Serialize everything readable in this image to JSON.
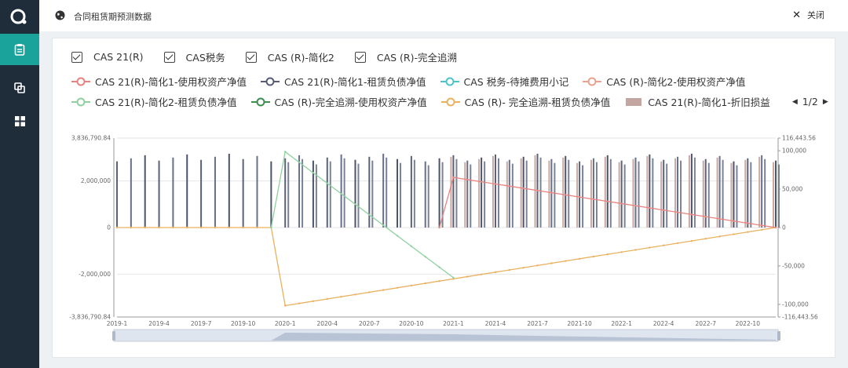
{
  "window": {
    "title": "合同租赁期预测数据",
    "close_label": "关闭"
  },
  "sidebar": {
    "items": [
      {
        "icon": "clipboard-icon"
      },
      {
        "icon": "copy-icon"
      },
      {
        "icon": "grid-icon"
      }
    ]
  },
  "filters": [
    "CAS 21(R)",
    "CAS税务",
    "CAS (R)-简化2",
    "CAS (R)-完全追溯"
  ],
  "legend": {
    "row1": [
      {
        "label": "CAS 21(R)-简化1-使用权资产净值",
        "color": "#e8827f",
        "kind": "line"
      },
      {
        "label": "CAS 21(R)-简化1-租赁负债净值",
        "color": "#565c77",
        "kind": "line"
      },
      {
        "label": "CAS 税务-待摊费用小记",
        "color": "#4ec3c9",
        "kind": "line"
      },
      {
        "label": "CAS (R)-简化2-使用权资产净值",
        "color": "#e8a08f",
        "kind": "line"
      }
    ],
    "row2": [
      {
        "label": "CAS 21(R)-简化2-租赁负债净值",
        "color": "#8fd19e",
        "kind": "line"
      },
      {
        "label": "CAS (R)-完全追溯-使用权资产净值",
        "color": "#3e8e50",
        "kind": "line"
      },
      {
        "label": "CAS (R)- 完全追溯-租赁负债净值",
        "color": "#e9b160",
        "kind": "line"
      },
      {
        "label": "CAS 21(R)-简化1-折旧损益",
        "color": "#c4a6a0",
        "kind": "bar"
      }
    ],
    "page": "1/2"
  },
  "chart_data": {
    "type": "bar",
    "left_axis": {
      "ticks": [
        "3,836,790.84",
        "2,000,000",
        "0",
        "-2,000,000",
        "-3,836,790.84"
      ],
      "range": [
        -3836790.84,
        3836790.84
      ]
    },
    "right_axis": {
      "ticks": [
        "116,443.56",
        "100,000",
        "50,000",
        "0",
        "-50,000",
        "-100,000",
        "-116,443.56"
      ],
      "range": [
        -116443.56,
        116443.56
      ]
    },
    "x_ticks": [
      "2019-1",
      "2019-4",
      "2019-7",
      "2019-10",
      "2020-1",
      "2020-4",
      "2020-7",
      "2020-10",
      "2021-1",
      "2021-4",
      "2021-7",
      "2021-10",
      "2022-1",
      "2022-4",
      "2022-7",
      "2022-10"
    ],
    "months": 48,
    "series": [
      {
        "name": "CAS 21(R)-简化1-折旧损益",
        "kind": "bar",
        "values_left": 3300000,
        "from": 0
      },
      {
        "name": "CAS (R)- 完全追溯-租赁负债净值",
        "kind": "line",
        "color": "#e9b160",
        "points": [
          [
            0,
            0
          ],
          [
            11,
            0
          ],
          [
            12,
            -3350000
          ],
          [
            47,
            0
          ]
        ]
      },
      {
        "name": "CAS 21(R)-简化2-租赁负债净值",
        "kind": "line",
        "color": "#8fd19e",
        "points": [
          [
            11,
            0
          ],
          [
            12,
            3250000
          ],
          [
            24,
            -2150000
          ]
        ]
      },
      {
        "name": "CAS 21(R)-简化1-使用权资产净值",
        "kind": "line",
        "color": "#e8827f",
        "points": [
          [
            23,
            0
          ],
          [
            24,
            2150000
          ],
          [
            47,
            0
          ]
        ]
      }
    ]
  }
}
